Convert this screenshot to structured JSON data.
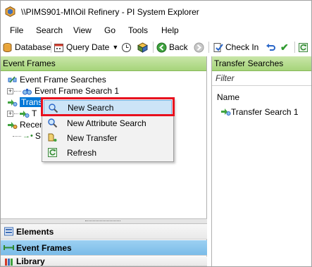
{
  "window": {
    "title": "\\\\PIMS901-MI\\Oil Refinery - PI System Explorer"
  },
  "menu": [
    "File",
    "Search",
    "View",
    "Go",
    "Tools",
    "Help"
  ],
  "toolbar": {
    "database": "Database",
    "query_date": "Query Date",
    "back": "Back",
    "check_in": "Check In"
  },
  "left_pane": {
    "header": "Event Frames",
    "tree": {
      "searches_root": "Event Frame Searches",
      "search_1": "Event Frame Search 1",
      "transfer_root": "Trans",
      "recent_root": "Recen",
      "recent_child": "S",
      "transfer_child": "T"
    }
  },
  "nav_panes": [
    "Elements",
    "Event Frames",
    "Library"
  ],
  "right_pane": {
    "header": "Transfer Searches",
    "filter_placeholder": "Filter",
    "column_name": "Name",
    "items": [
      "Transfer Search 1"
    ]
  },
  "context_menu": {
    "items": [
      "New Search",
      "New Attribute Search",
      "New Transfer",
      "Refresh"
    ]
  },
  "colors": {
    "green_header": "#a6d47a",
    "selected_nav": "#7bbce8",
    "highlight_box": "#e8101e"
  }
}
